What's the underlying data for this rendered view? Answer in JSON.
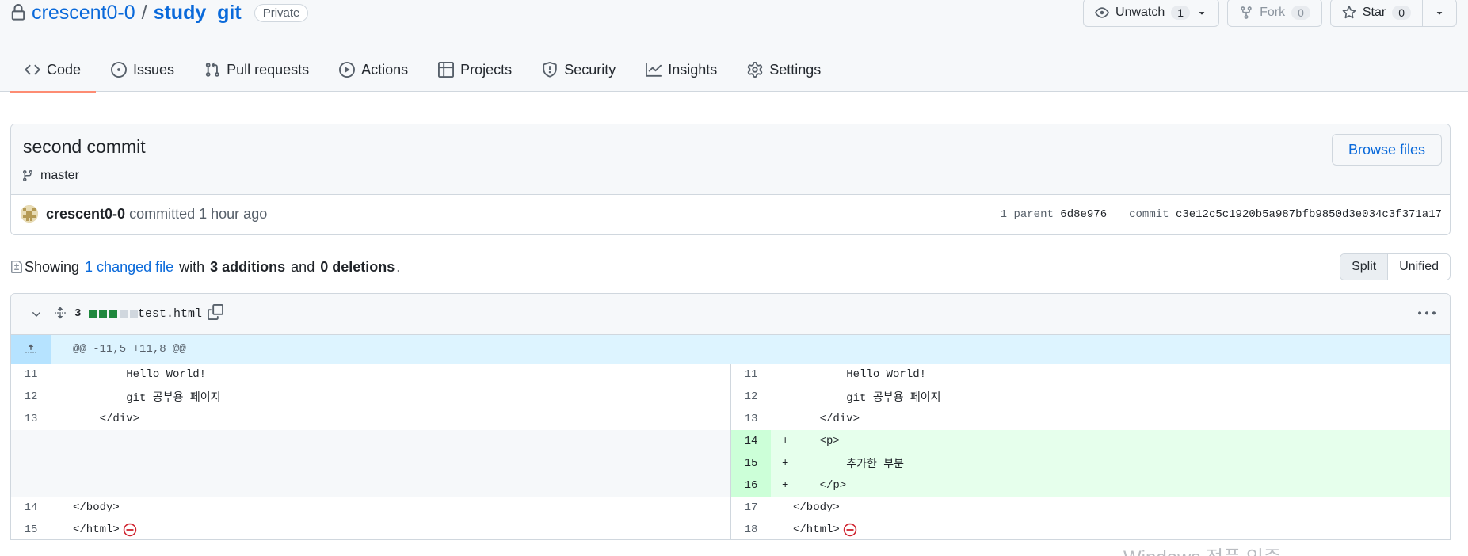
{
  "repo": {
    "owner": "crescent0-0",
    "separator": "/",
    "name": "study_git",
    "visibility": "Private"
  },
  "actions": {
    "watch_label": "Unwatch",
    "watch_count": "1",
    "fork_label": "Fork",
    "fork_count": "0",
    "star_label": "Star",
    "star_count": "0"
  },
  "nav": {
    "tabs": [
      {
        "label": "Code",
        "icon": "code-icon"
      },
      {
        "label": "Issues",
        "icon": "issue-opened-icon"
      },
      {
        "label": "Pull requests",
        "icon": "git-pull-request-icon"
      },
      {
        "label": "Actions",
        "icon": "play-icon"
      },
      {
        "label": "Projects",
        "icon": "table-icon"
      },
      {
        "label": "Security",
        "icon": "shield-icon"
      },
      {
        "label": "Insights",
        "icon": "graph-icon"
      },
      {
        "label": "Settings",
        "icon": "gear-icon"
      }
    ],
    "selected": "Code"
  },
  "commit": {
    "title": "second commit",
    "branch": "master",
    "browse_label": "Browse files",
    "author": "crescent0-0",
    "action": "committed",
    "time": "1 hour ago",
    "parent_label": "1 parent",
    "parent_sha": "6d8e976",
    "commit_label": "commit",
    "commit_sha": "c3e12c5c1920b5a987bfb9850d3e034c3f371a17"
  },
  "toc": {
    "showing": "Showing",
    "changed_files": "1 changed file",
    "with": "with",
    "additions": "3 additions",
    "and": "and",
    "deletions": "0 deletions",
    "period": ".",
    "split_label": "Split",
    "unified_label": "Unified"
  },
  "file": {
    "changes": "3",
    "diffstat": [
      "added",
      "added",
      "added",
      "neutral",
      "neutral"
    ],
    "name": "test.html",
    "hunk_header": "@@ -11,5 +11,8 @@",
    "left": [
      {
        "num": "11",
        "code": "        Hello World!",
        "type": "context"
      },
      {
        "num": "12",
        "code": "        git 공부용 페이지",
        "type": "context"
      },
      {
        "num": "13",
        "code": "    </div>",
        "type": "context"
      },
      {
        "num": "",
        "code": "",
        "type": "empty"
      },
      {
        "num": "",
        "code": "",
        "type": "empty"
      },
      {
        "num": "",
        "code": "",
        "type": "empty"
      },
      {
        "num": "14",
        "code": "</body>",
        "type": "context"
      },
      {
        "num": "15",
        "code": "</html>",
        "type": "context",
        "no_newline": true
      }
    ],
    "right": [
      {
        "num": "11",
        "code": "        Hello World!",
        "type": "context"
      },
      {
        "num": "12",
        "code": "        git 공부용 페이지",
        "type": "context"
      },
      {
        "num": "13",
        "code": "    </div>",
        "type": "context"
      },
      {
        "num": "14",
        "code": "    <p>",
        "type": "add"
      },
      {
        "num": "15",
        "code": "        추가한 부분",
        "type": "add"
      },
      {
        "num": "16",
        "code": "    </p>",
        "type": "add"
      },
      {
        "num": "17",
        "code": "</body>",
        "type": "context"
      },
      {
        "num": "18",
        "code": "</html>",
        "type": "context",
        "no_newline": true
      }
    ]
  },
  "colors": {
    "accent": "#0969da",
    "tab_underline": "#fd8c73",
    "add_bg": "#e6ffec",
    "add_num_bg": "#ccffd8",
    "hunk_bg": "#ddf4ff",
    "diffstat_added": "#1f883d",
    "diffstat_neutral": "#d0d7de",
    "no_newline": "#cf222e"
  },
  "watermark": "Windows 정품 인증"
}
